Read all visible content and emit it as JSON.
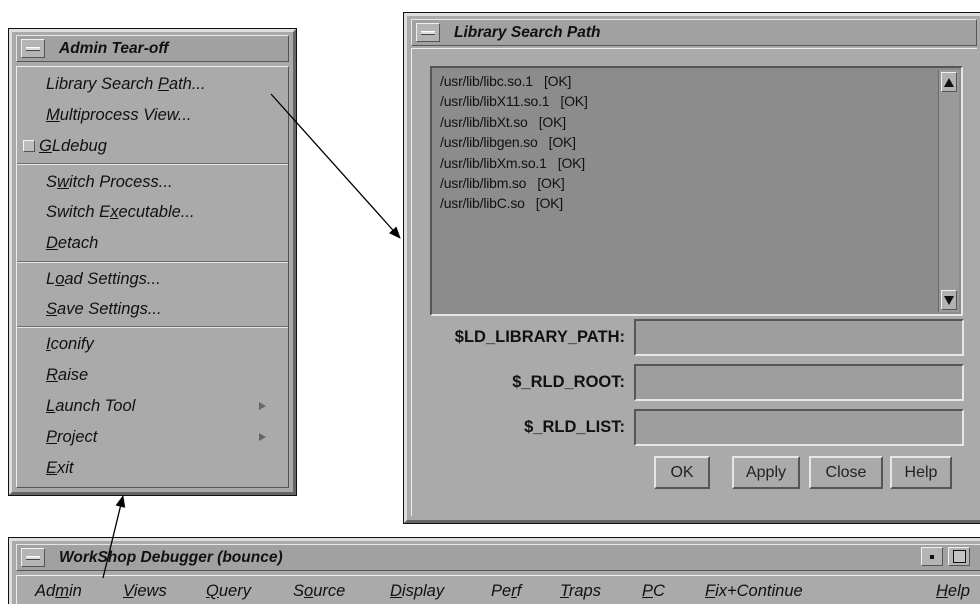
{
  "admin_menu": {
    "title": "Admin Tear-off",
    "items": [
      {
        "pre": "Library Search ",
        "mn": "P",
        "post": "ath..."
      },
      {
        "pre": "",
        "mn": "M",
        "post": "ultiprocess View..."
      },
      {
        "pre": "",
        "mn": "G",
        "post": "Ldebug"
      },
      {
        "pre": "S",
        "mn": "w",
        "post": "itch Process..."
      },
      {
        "pre": "Switch E",
        "mn": "x",
        "post": "ecutable..."
      },
      {
        "pre": "",
        "mn": "D",
        "post": "etach"
      },
      {
        "pre": "L",
        "mn": "o",
        "post": "ad Settings..."
      },
      {
        "pre": "",
        "mn": "S",
        "post": "ave Settings..."
      },
      {
        "pre": "",
        "mn": "I",
        "post": "conify"
      },
      {
        "pre": "",
        "mn": "R",
        "post": "aise"
      },
      {
        "pre": "",
        "mn": "L",
        "post": "aunch Tool"
      },
      {
        "pre": "",
        "mn": "P",
        "post": "roject"
      },
      {
        "pre": "",
        "mn": "E",
        "post": "xit"
      }
    ],
    "gldebug_checked": false
  },
  "library_search_path": {
    "title": "Library Search Path",
    "libraries": [
      "/usr/lib/libc.so.1   [OK]",
      "/usr/lib/libX11.so.1   [OK]",
      "/usr/lib/libXt.so   [OK]",
      "/usr/lib/libgen.so   [OK]",
      "/usr/lib/libXm.so.1   [OK]",
      "/usr/lib/libm.so   [OK]",
      "/usr/lib/libC.so   [OK]"
    ],
    "fields": {
      "ld_library_path_label": "$LD_LIBRARY_PATH:",
      "ld_library_path_value": "",
      "rld_root_label": "$_RLD_ROOT:",
      "rld_root_value": "",
      "rld_list_label": "$_RLD_LIST:",
      "rld_list_value": ""
    },
    "buttons": {
      "ok": "OK",
      "apply": "Apply",
      "close": "Close",
      "help": "Help"
    }
  },
  "debugger_window": {
    "title": "WorkShop Debugger (bounce)",
    "menus": [
      {
        "pre": "Ad",
        "mn": "m",
        "post": "in"
      },
      {
        "pre": "",
        "mn": "V",
        "post": "iews"
      },
      {
        "pre": "",
        "mn": "Q",
        "post": "uery"
      },
      {
        "pre": "S",
        "mn": "o",
        "post": "urce"
      },
      {
        "pre": "",
        "mn": "D",
        "post": "isplay"
      },
      {
        "pre": "Pe",
        "mn": "r",
        "post": "f"
      },
      {
        "pre": "",
        "mn": "T",
        "post": "raps"
      },
      {
        "pre": "",
        "mn": "P",
        "post": "C"
      },
      {
        "pre": "",
        "mn": "F",
        "post": "ix+Continue"
      },
      {
        "pre": "",
        "mn": "H",
        "post": "elp"
      }
    ]
  },
  "icons": {
    "window_menu": "window-menu-icon",
    "submenu": "submenu-arrow-icon",
    "scroll_up": "scroll-up-arrow-icon",
    "scroll_down": "scroll-down-arrow-icon",
    "minimize": "minimize-icon",
    "maximize": "maximize-icon"
  },
  "colors": {
    "chrome": "#aaaaaa",
    "list_background": "#8c8c8c",
    "arrow": "#000000"
  }
}
